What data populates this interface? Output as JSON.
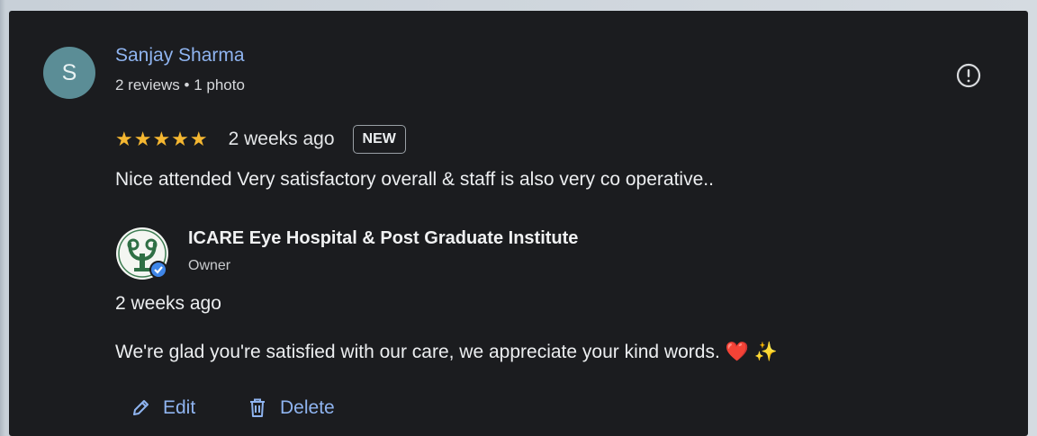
{
  "review": {
    "reviewer": {
      "initial": "S",
      "name": "Sanjay Sharma",
      "meta": "2 reviews • 1 photo",
      "avatar_color": "#5b8d96"
    },
    "flag_icon": "flag-report-icon",
    "rating": {
      "value": 5,
      "max": 5,
      "stars_text": "★★★★★",
      "star_color": "#f5b731"
    },
    "time_ago": "2 weeks ago",
    "badge": "NEW",
    "text": "Nice attended Very satisfactory overall & staff is also very co operative.."
  },
  "owner_reply": {
    "name": "ICARE Eye Hospital & Post Graduate Institute",
    "role": "Owner",
    "verified": true,
    "time_ago": "2 weeks ago",
    "text": "We're glad you're satisfied with our care, we appreciate your kind words. ❤️ ✨"
  },
  "actions": {
    "edit_label": "Edit",
    "delete_label": "Delete",
    "link_color": "#8fb4f0"
  }
}
